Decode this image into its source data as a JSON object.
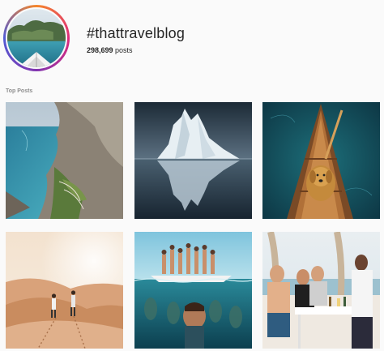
{
  "header": {
    "hashtag": "#thattravelblog",
    "post_count": "298,699",
    "post_count_suffix": " posts"
  },
  "sections": {
    "top_posts_label": "Top Posts"
  },
  "posts": [
    {
      "subject": "coastal cliffs with winding road"
    },
    {
      "subject": "iceberg reflected in water"
    },
    {
      "subject": "golden retriever in wooden canoe"
    },
    {
      "subject": "two people walking on desert dunes"
    },
    {
      "subject": "group on boat with underwater selfie"
    },
    {
      "subject": "people at outdoor table near sea"
    }
  ],
  "colors": {
    "background": "#fafafa",
    "text_primary": "#262626",
    "text_secondary": "#8e8e8e"
  }
}
